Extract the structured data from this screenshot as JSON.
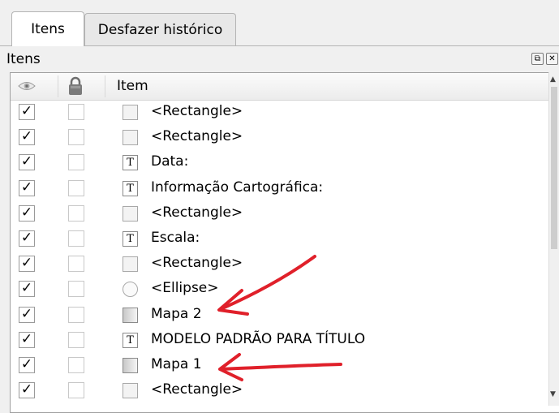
{
  "tabs": [
    {
      "label": "Itens",
      "active": true
    },
    {
      "label": "Desfazer histórico",
      "active": false
    }
  ],
  "panel": {
    "title": "Itens",
    "float_icon": "float-icon",
    "close_icon": "close-icon"
  },
  "columns": {
    "visible_icon": "eye-icon",
    "lock_icon": "lock-icon",
    "item": "Item"
  },
  "items": [
    {
      "visible": true,
      "locked": false,
      "icon": "rectangle-icon",
      "label": "<Rectangle>"
    },
    {
      "visible": true,
      "locked": false,
      "icon": "rectangle-icon",
      "label": "<Rectangle>"
    },
    {
      "visible": true,
      "locked": false,
      "icon": "text-icon",
      "label": "Data:"
    },
    {
      "visible": true,
      "locked": false,
      "icon": "text-icon",
      "label": "Informação Cartográfica:"
    },
    {
      "visible": true,
      "locked": false,
      "icon": "rectangle-icon",
      "label": "<Rectangle>"
    },
    {
      "visible": true,
      "locked": false,
      "icon": "text-icon",
      "label": "Escala:"
    },
    {
      "visible": true,
      "locked": false,
      "icon": "rectangle-icon",
      "label": "<Rectangle>"
    },
    {
      "visible": true,
      "locked": false,
      "icon": "ellipse-icon",
      "label": "<Ellipse>"
    },
    {
      "visible": true,
      "locked": false,
      "icon": "map-icon",
      "label": "Mapa 2"
    },
    {
      "visible": true,
      "locked": false,
      "icon": "text-icon",
      "label": "MODELO PADRÃO PARA TÍTULO"
    },
    {
      "visible": true,
      "locked": false,
      "icon": "map-icon",
      "label": "Mapa 1"
    },
    {
      "visible": true,
      "locked": false,
      "icon": "rectangle-icon",
      "label": "<Rectangle>"
    }
  ],
  "check_glyph": "✓",
  "text_icon_glyph": "T",
  "annotation_color": "#e0202a"
}
